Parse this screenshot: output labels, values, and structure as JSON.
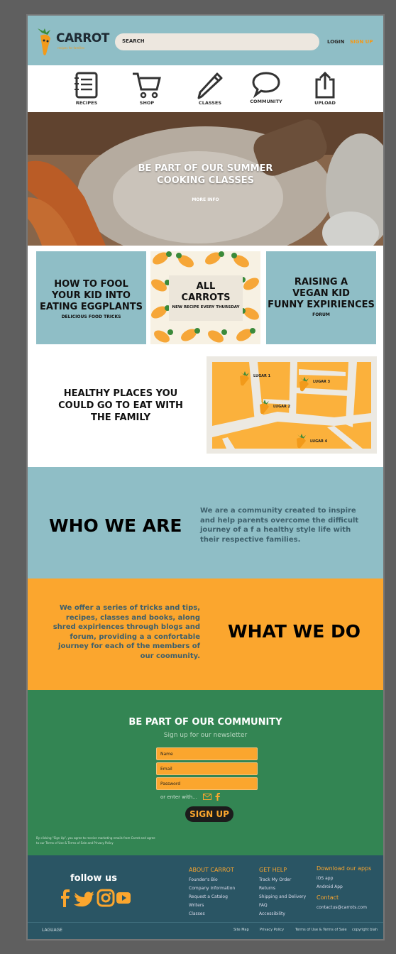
{
  "header": {
    "logo_text": "CARROT",
    "logo_sub": "recipes for families",
    "search_placeholder": "SEARCH",
    "login": "LOGIN",
    "signup": "SIGN UP"
  },
  "nav": [
    {
      "label": "RECIPES",
      "icon": "recipes-icon"
    },
    {
      "label": "SHOP",
      "icon": "cart-icon"
    },
    {
      "label": "CLASSES",
      "icon": "pencil-icon"
    },
    {
      "label": "COMMUNITY",
      "icon": "chat-icon"
    },
    {
      "label": "UPLOAD",
      "icon": "upload-icon"
    }
  ],
  "hero": {
    "title_line1": "BE PART OF OUR SUMMER",
    "title_line2": "COOKING CLASSES",
    "more": "MORE INFO"
  },
  "cards": {
    "c1": {
      "t1": "HOW TO FOOL",
      "t2": "YOUR KID INTO",
      "t3": "EATING EGGPLANTS",
      "sub": "DELICIOUS FOOD TRICKS"
    },
    "c2": {
      "t1": "ALL",
      "t2": "CARROTS",
      "sub": "NEW RECIPE EVERY THURSDAY"
    },
    "c3": {
      "t1": "RAISING A",
      "t2": "VEGAN KID",
      "t3": "FUNNY EXPIRIENCES",
      "sub": "FORUM"
    }
  },
  "healthy": {
    "title": "HEALTHY PLACES YOU COULD GO TO EAT WITH THE FAMILY",
    "places": [
      "LUGAR 1",
      "LUGAR 2",
      "LUGAR 3",
      "LUGAR 4"
    ]
  },
  "who": {
    "heading": "WHO WE ARE",
    "text": "We are a community  created to inspire and help parents overcome the difficult journey of a f a healthy style life with their respective families."
  },
  "what": {
    "heading": "WHAT WE DO",
    "text": "We offer a series of tricks and tips, recipes, classes and books, along shred expirlences through blogs and forum, providing a a confortable journey for each of the members of our coomunity."
  },
  "community": {
    "title": "BE PART OF OUR COMMUNITY",
    "subtitle": "Sign up for our newsletter",
    "name": "Name",
    "email": "Email",
    "password": "Password",
    "enter": "or enter with...",
    "button": "SIGN UP",
    "legal": "By clicking \"Sign Up\", you agree to receive marketing emails from Carrot and agree to our Terms of Use & Terms of Sale and Privacy Policy"
  },
  "footer": {
    "follow": "follow us",
    "about": {
      "head": "ABOUT CARROT",
      "items": [
        "Founder's Bio",
        "Company Information",
        "Request a Catalog",
        "Writers",
        "Classes"
      ]
    },
    "help": {
      "head": "GET HELP",
      "items": [
        "Track My Order",
        "Returns",
        "Shipping and Delivery",
        "FAQ",
        "Accessibility"
      ]
    },
    "apps": {
      "head": "Download our apps",
      "items": [
        "iOS app",
        "Android App"
      ],
      "contact_head": "Contact",
      "contact": "contactus@carrots.com"
    },
    "language": "LAGUAGE",
    "sitemap": "Site Map",
    "privacy": "Privacy Policy",
    "terms": "Terms of Use & Terms of Sale",
    "copyright": "copyright blah"
  },
  "colors": {
    "teal": "#8fbec6",
    "orange": "#fba62e",
    "green": "#338553",
    "navy": "#2a5564"
  }
}
